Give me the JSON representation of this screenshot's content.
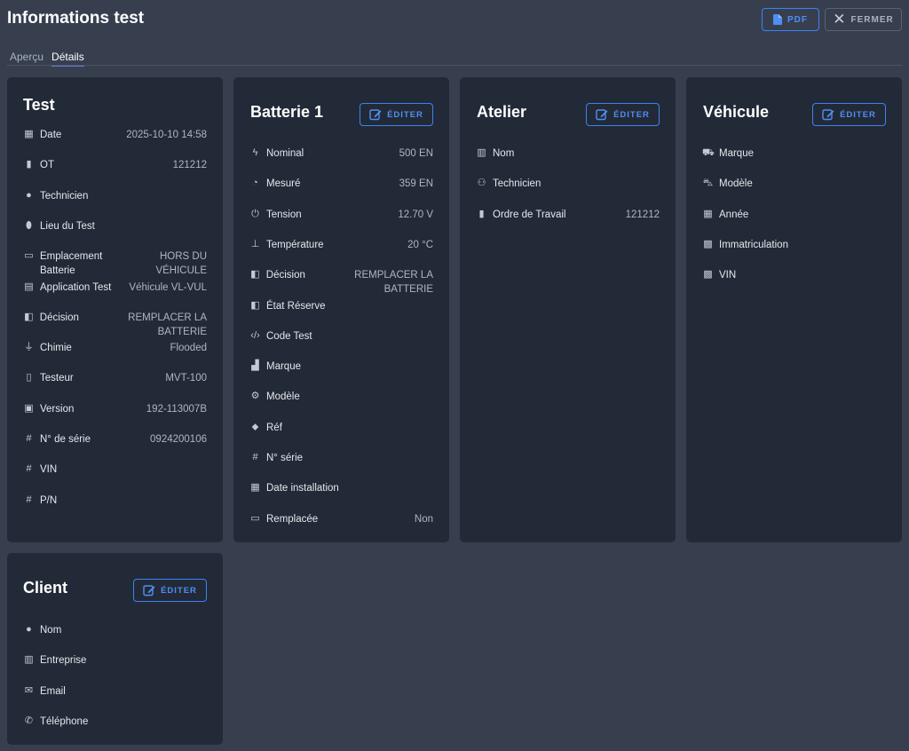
{
  "header": {
    "title": "Informations test",
    "pdf_label": "PDF",
    "close_label": "FERMER"
  },
  "tabs": [
    {
      "label": "Aperçu",
      "active": false
    },
    {
      "label": "Détails",
      "active": true
    }
  ],
  "edit_label": "ÉDITER",
  "test": {
    "title": "Test",
    "rows": [
      {
        "icon": "calendar-icon",
        "label": "Date",
        "value": "2025-10-10 14:58"
      },
      {
        "icon": "clipboard-icon",
        "label": "OT",
        "value": "121212"
      },
      {
        "icon": "person-icon",
        "label": "Technicien",
        "value": ""
      },
      {
        "icon": "location-pin-icon",
        "label": "Lieu du Test",
        "value": ""
      },
      {
        "icon": "battery-icon",
        "label": "Emplacement Batterie",
        "value": "HORS DU VÉHICULE"
      },
      {
        "icon": "clipboard-list-icon",
        "label": "Application Test",
        "value": "Véhicule VL-VUL"
      },
      {
        "icon": "file-decision-icon",
        "label": "Décision",
        "value": "REMPLACER LA BATTERIE"
      },
      {
        "icon": "flask-icon",
        "label": "Chimie",
        "value": "Flooded"
      },
      {
        "icon": "tablet-icon",
        "label": "Testeur",
        "value": "MVT-100"
      },
      {
        "icon": "chip-icon",
        "label": "Version",
        "value": "192-113007B"
      },
      {
        "icon": "hash-icon",
        "label": "N° de série",
        "value": "0924200106"
      },
      {
        "icon": "hash-icon",
        "label": "VIN",
        "value": ""
      },
      {
        "icon": "hash-icon",
        "label": "P/N",
        "value": ""
      }
    ]
  },
  "battery": {
    "title": "Batterie 1",
    "rows": [
      {
        "icon": "bolt-icon",
        "label": "Nominal",
        "value": "500 EN"
      },
      {
        "icon": "gauge-icon",
        "label": "Mesuré",
        "value": "359 EN"
      },
      {
        "icon": "plug-icon",
        "label": "Tension",
        "value": "12.70 V"
      },
      {
        "icon": "thermometer-icon",
        "label": "Température",
        "value": "20 °C"
      },
      {
        "icon": "file-decision-icon",
        "label": "Décision",
        "value": "REMPLACER LA BATTERIE"
      },
      {
        "icon": "file-decision-icon",
        "label": "État Réserve",
        "value": ""
      },
      {
        "icon": "code-icon",
        "label": "Code Test",
        "value": ""
      },
      {
        "icon": "factory-icon",
        "label": "Marque",
        "value": ""
      },
      {
        "icon": "gears-icon",
        "label": "Modèle",
        "value": ""
      },
      {
        "icon": "tag-icon",
        "label": "Réf",
        "value": ""
      },
      {
        "icon": "hash-icon",
        "label": "N° série",
        "value": ""
      },
      {
        "icon": "calendar-icon",
        "label": "Date installation",
        "value": ""
      },
      {
        "icon": "battery-icon",
        "label": "Remplacée",
        "value": "Non"
      }
    ]
  },
  "workshop": {
    "title": "Atelier",
    "rows": [
      {
        "icon": "warehouse-icon",
        "label": "Nom",
        "value": ""
      },
      {
        "icon": "user-gear-icon",
        "label": "Technicien",
        "value": ""
      },
      {
        "icon": "clipboard-icon",
        "label": "Ordre de Travail",
        "value": "121212"
      }
    ]
  },
  "vehicle": {
    "title": "Véhicule",
    "rows": [
      {
        "icon": "car-icon",
        "label": "Marque",
        "value": ""
      },
      {
        "icon": "car-side-icon",
        "label": "Modèle",
        "value": ""
      },
      {
        "icon": "calendar-icon",
        "label": "Année",
        "value": ""
      },
      {
        "icon": "id-card-icon",
        "label": "Immatriculation",
        "value": ""
      },
      {
        "icon": "id-card-icon",
        "label": "VIN",
        "value": ""
      }
    ]
  },
  "client": {
    "title": "Client",
    "rows": [
      {
        "icon": "person-icon",
        "label": "Nom",
        "value": ""
      },
      {
        "icon": "building-icon",
        "label": "Entreprise",
        "value": ""
      },
      {
        "icon": "envelope-icon",
        "label": "Email",
        "value": ""
      },
      {
        "icon": "phone-icon",
        "label": "Téléphone",
        "value": ""
      }
    ]
  },
  "colors": {
    "background": "#373f4f",
    "card": "#232a37",
    "accent": "#3b82f6"
  }
}
